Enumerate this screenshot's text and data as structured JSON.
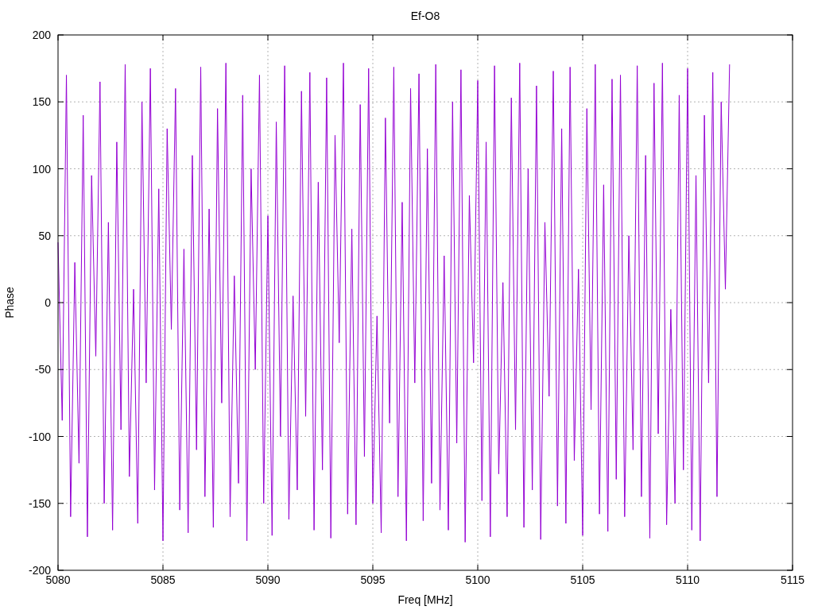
{
  "chart_data": {
    "type": "line",
    "title": "Ef-O8",
    "xlabel": "Freq [MHz]",
    "ylabel": "Phase",
    "grid": true,
    "xlim": [
      5080,
      5115
    ],
    "ylim": [
      -200,
      200
    ],
    "xticks": [
      5080,
      5085,
      5090,
      5095,
      5100,
      5105,
      5110,
      5115
    ],
    "yticks": [
      -200,
      -150,
      -100,
      -50,
      0,
      50,
      100,
      150,
      200
    ],
    "x": [
      5080,
      5080.2,
      5080.4,
      5080.6,
      5080.8,
      5081,
      5081.2,
      5081.4,
      5081.6,
      5081.8,
      5082,
      5082.2,
      5082.4,
      5082.6,
      5082.8,
      5083,
      5083.2,
      5083.4,
      5083.6,
      5083.8,
      5084,
      5084.2,
      5084.4,
      5084.6,
      5084.8,
      5085,
      5085.2,
      5085.4,
      5085.6,
      5085.8,
      5086,
      5086.2,
      5086.4,
      5086.6,
      5086.8,
      5087,
      5087.2,
      5087.4,
      5087.6,
      5087.8,
      5088,
      5088.2,
      5088.4,
      5088.6,
      5088.8,
      5089,
      5089.2,
      5089.4,
      5089.6,
      5089.8,
      5090,
      5090.2,
      5090.4,
      5090.6,
      5090.8,
      5091,
      5091.2,
      5091.4,
      5091.6,
      5091.8,
      5092,
      5092.2,
      5092.4,
      5092.6,
      5092.8,
      5093,
      5093.2,
      5093.4,
      5093.6,
      5093.8,
      5094,
      5094.2,
      5094.4,
      5094.6,
      5094.8,
      5095,
      5095.2,
      5095.4,
      5095.6,
      5095.8,
      5096,
      5096.2,
      5096.4,
      5096.6,
      5096.8,
      5097,
      5097.2,
      5097.4,
      5097.6,
      5097.8,
      5098,
      5098.2,
      5098.4,
      5098.6,
      5098.8,
      5099,
      5099.2,
      5099.4,
      5099.6,
      5099.8,
      5100,
      5100.2,
      5100.4,
      5100.6,
      5100.8,
      5101,
      5101.2,
      5101.4,
      5101.6,
      5101.8,
      5102,
      5102.2,
      5102.4,
      5102.6,
      5102.8,
      5103,
      5103.2,
      5103.4,
      5103.6,
      5103.8,
      5104,
      5104.2,
      5104.4,
      5104.6,
      5104.8,
      5105,
      5105.2,
      5105.4,
      5105.6,
      5105.8,
      5106,
      5106.2,
      5106.4,
      5106.6,
      5106.8,
      5107,
      5107.2,
      5107.4,
      5107.6,
      5107.8,
      5108,
      5108.2,
      5108.4,
      5108.6,
      5108.8,
      5109,
      5109.2,
      5109.4,
      5109.6,
      5109.8,
      5110,
      5110.2,
      5110.4,
      5110.6,
      5110.8,
      5111,
      5111.2,
      5111.4,
      5111.6,
      5111.8,
      5112
    ],
    "series": [
      {
        "color": "#9400d3",
        "values": [
          45,
          -88,
          170,
          -160,
          30,
          -120,
          140,
          -175,
          95,
          -40,
          165,
          -150,
          60,
          -170,
          120,
          -95,
          178,
          -130,
          10,
          -165,
          150,
          -60,
          175,
          -140,
          85,
          -178,
          130,
          -20,
          160,
          -155,
          40,
          -172,
          110,
          -110,
          176,
          -145,
          70,
          -168,
          145,
          -75,
          179,
          -160,
          20,
          -135,
          155,
          -178,
          100,
          -50,
          170,
          -150,
          65,
          -174,
          135,
          -100,
          177,
          -162,
          5,
          -140,
          158,
          -85,
          172,
          -170,
          90,
          -125,
          168,
          -176,
          125,
          -30,
          179,
          -158,
          55,
          -166,
          148,
          -115,
          175,
          -150,
          -10,
          -172,
          138,
          -90,
          176,
          -145,
          75,
          -178,
          160,
          -60,
          171,
          -163,
          115,
          -135,
          178,
          -155,
          35,
          -170,
          150,
          -105,
          174,
          -179,
          80,
          -45,
          166,
          -148,
          120,
          -175,
          177,
          -128,
          15,
          -160,
          153,
          -95,
          179,
          -168,
          100,
          -140,
          162,
          -177,
          60,
          -70,
          173,
          -152,
          130,
          -165,
          176,
          -118,
          25,
          -174,
          145,
          -80,
          178,
          -158,
          88,
          -171,
          167,
          -132,
          170,
          -160,
          50,
          -110,
          177,
          -145,
          110,
          -176,
          164,
          -98,
          179,
          -166,
          -5,
          -150,
          155,
          -125,
          175,
          -170,
          95,
          -178,
          140,
          -60,
          172,
          -145,
          150,
          10,
          178
        ]
      }
    ]
  }
}
